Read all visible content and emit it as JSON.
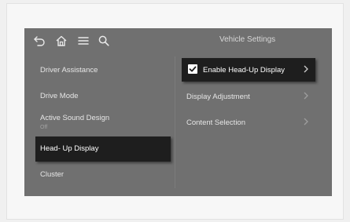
{
  "screen": {
    "title": "Vehicle Settings"
  },
  "toolbar": {
    "icons": [
      "back-icon",
      "home-icon",
      "menu-icon",
      "search-icon"
    ]
  },
  "left_menu": {
    "items": [
      {
        "label": "Driver Assistance",
        "sub": ""
      },
      {
        "label": "Drive Mode",
        "sub": ""
      },
      {
        "label": "Active Sound Design",
        "sub": "Off"
      },
      {
        "label": "Head- Up Display",
        "sub": "",
        "selected": true
      },
      {
        "label": "Cluster",
        "sub": ""
      }
    ]
  },
  "right_menu": {
    "items": [
      {
        "label": "Enable Head-Up Display",
        "checked": true,
        "selected": true
      },
      {
        "label": "Display Adjustment"
      },
      {
        "label": "Content Selection"
      }
    ]
  },
  "colors": {
    "screen_bg": "#707070",
    "selected_bg": "#1e1e1e",
    "text": "#e6e6e6"
  }
}
